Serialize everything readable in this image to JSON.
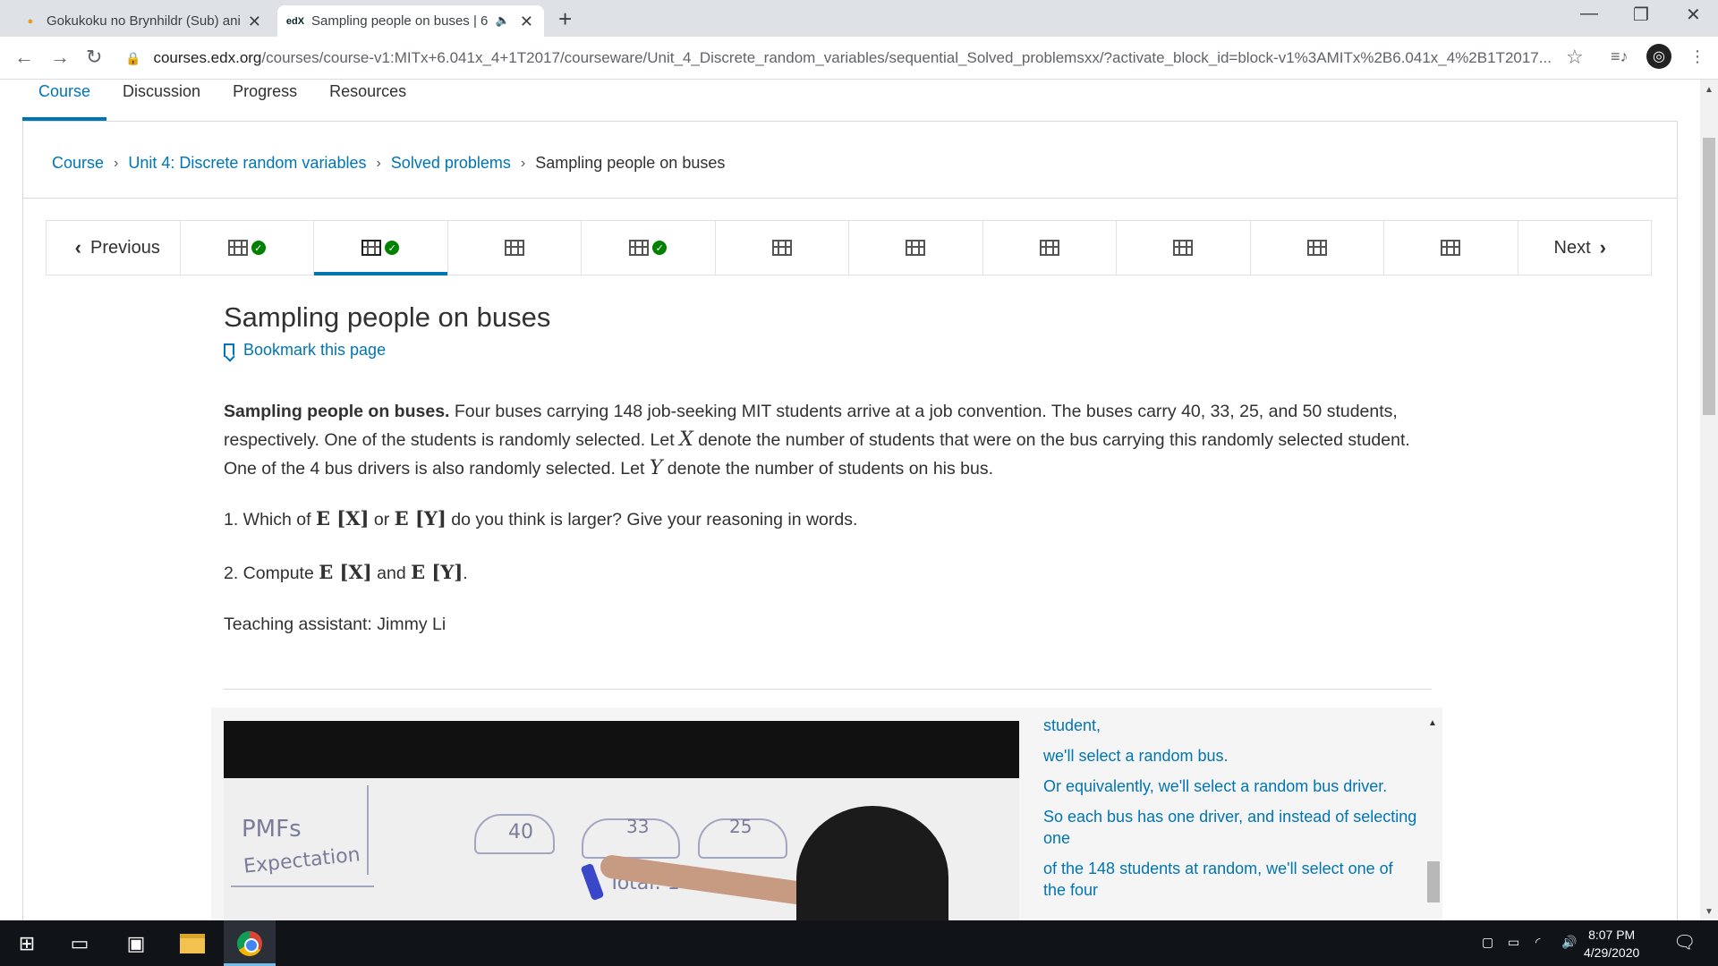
{
  "browser": {
    "tabs": [
      {
        "title": "Gokukoku no Brynhildr (Sub) ani",
        "favicon": "anime-site-icon"
      },
      {
        "title": "Sampling people on buses | 6",
        "favicon": "edx-icon",
        "active": true
      }
    ],
    "url_host": "courses.edx.org",
    "url_path": "/courses/course-v1:MITx+6.041x_4+1T2017/courseware/Unit_4_Discrete_random_variables/sequential_Solved_problemsxx/?activate_block_id=block-v1%3AMITx%2B6.041x_4%2B1T2017..."
  },
  "course_nav": {
    "tabs": [
      "Course",
      "Discussion",
      "Progress",
      "Resources"
    ],
    "active": "Course"
  },
  "breadcrumbs": [
    "Course",
    "Unit 4: Discrete random variables",
    "Solved problems",
    "Sampling people on buses"
  ],
  "sequence": {
    "previous": "Previous",
    "next": "Next",
    "items": [
      {
        "type": "video",
        "completed": true
      },
      {
        "type": "video",
        "completed": true,
        "active": true
      },
      {
        "type": "video",
        "completed": false
      },
      {
        "type": "video",
        "completed": true
      },
      {
        "type": "video",
        "completed": false
      },
      {
        "type": "video",
        "completed": false
      },
      {
        "type": "video",
        "completed": false
      },
      {
        "type": "video",
        "completed": false
      },
      {
        "type": "video",
        "completed": false
      },
      {
        "type": "video",
        "completed": false
      }
    ]
  },
  "unit": {
    "title": "Sampling people on buses",
    "bookmark": "Bookmark this page",
    "problem_lead": "Sampling people on buses.",
    "problem_1": " Four buses carrying 148 job-seeking MIT students arrive at a job convention. The buses carry 40, 33, 25, and 50 students, respectively. One of the students is randomly selected. Let ",
    "var_x": "X",
    "problem_2": " denote the number of students that were on the bus carrying this randomly selected student. One of the 4 bus drivers is also randomly selected. Let ",
    "var_y": "Y",
    "problem_3": " denote the number of students on his bus.",
    "q1_a": "1. Which of ",
    "q1_b": " or ",
    "q1_c": " do you think is larger? Give your reasoning in words.",
    "q2_a": "2. Compute ",
    "q2_b": " and ",
    "q2_c": ".",
    "expect_x": "E [X]",
    "expect_y": "E [Y]",
    "ta": "Teaching assistant: Jimmy Li"
  },
  "video": {
    "whiteboard": [
      "PMFs",
      "Expectation",
      "40",
      "33",
      "25",
      "Total: 148"
    ]
  },
  "transcript": [
    "student,",
    "we'll select a random bus.",
    "Or equivalently, we'll select a random bus driver.",
    "So each bus has one driver, and instead of selecting one",
    "of the 148 students at random, we'll select one of the four"
  ],
  "taskbar": {
    "time": "8:07 PM",
    "date": "4/29/2020"
  }
}
